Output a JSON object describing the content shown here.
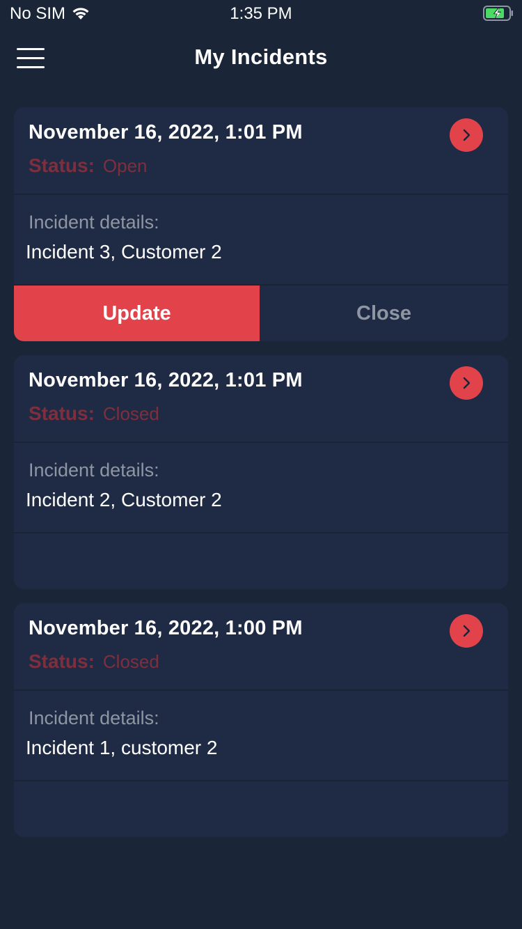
{
  "status_bar": {
    "carrier": "No SIM",
    "time": "1:35 PM",
    "wifi_icon": "wifi-icon",
    "battery_icon": "battery-charging-icon"
  },
  "header": {
    "title": "My Incidents",
    "menu_icon": "hamburger-menu-icon"
  },
  "colors": {
    "background": "#1b2538",
    "card": "#1f2b44",
    "accent": "#e2434a",
    "status_text": "#7e2f3e",
    "muted_text": "#8f96a3"
  },
  "incidents": [
    {
      "date": "November 16, 2022, 1:01 PM",
      "status_label": "Status:",
      "status_value": "Open",
      "details_label": "Incident details:",
      "details_value": "Incident 3, Customer 2",
      "update_label": "Update",
      "close_label": "Close"
    },
    {
      "date": "November 16, 2022, 1:01 PM",
      "status_label": "Status:",
      "status_value": "Closed",
      "details_label": "Incident details:",
      "details_value": "Incident 2, Customer 2"
    },
    {
      "date": "November 16, 2022, 1:00 PM",
      "status_label": "Status:",
      "status_value": "Closed",
      "details_label": "Incident details:",
      "details_value": "Incident 1, customer 2"
    }
  ]
}
